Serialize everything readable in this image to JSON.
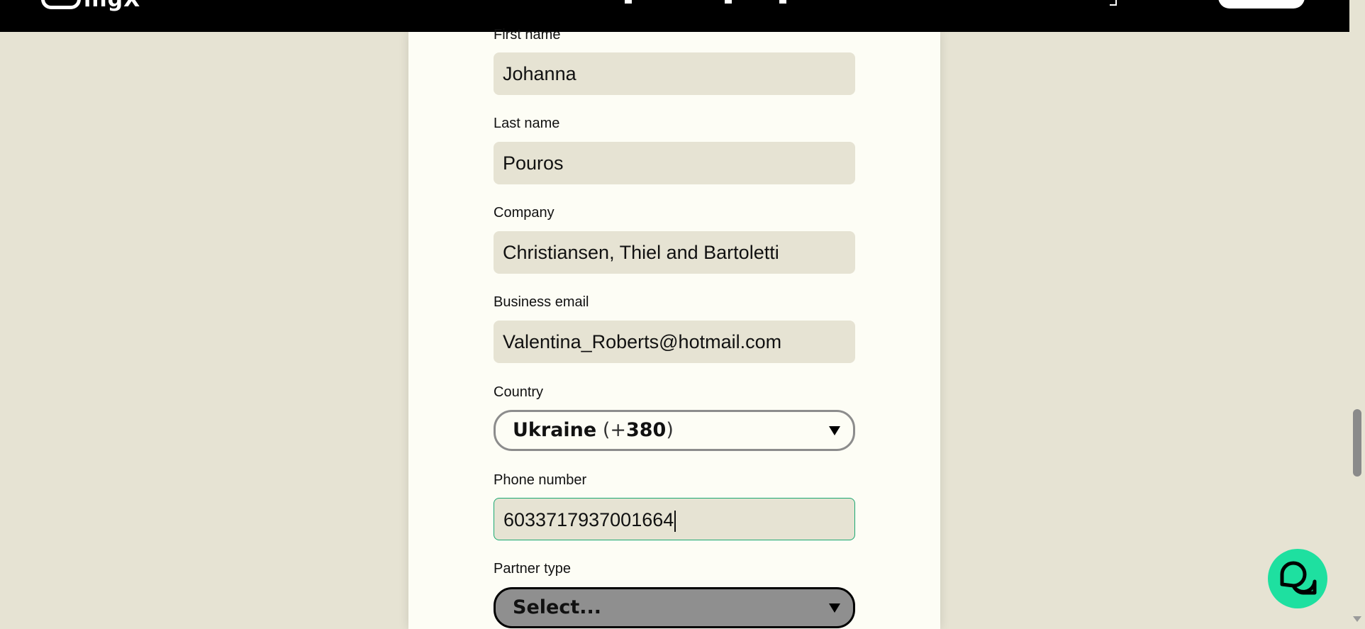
{
  "header": {
    "logo_text": "ingX"
  },
  "form": {
    "first_name": {
      "label": "First name",
      "value": "Johanna"
    },
    "last_name": {
      "label": "Last name",
      "value": "Pouros"
    },
    "company": {
      "label": "Company",
      "value": "Christiansen, Thiel and Bartoletti"
    },
    "business_email": {
      "label": "Business email",
      "value": "Valentina_Roberts@hotmail.com"
    },
    "country": {
      "label": "Country",
      "selected_name": "Ukraine",
      "code_open": "(+",
      "code_digits": "380",
      "code_close": ")"
    },
    "phone": {
      "label": "Phone number",
      "value": "6033717937001664"
    },
    "partner_type": {
      "label": "Partner type",
      "selected": "Select..."
    }
  },
  "colors": {
    "page_background": "#e6e3d3",
    "card_background": "#fdfdf5",
    "accent_green": "#1ee0a0",
    "focus_border": "#1aa871"
  },
  "icons": {
    "chat": "chat-bubbles-icon",
    "dropdown": "triangle-down-icon"
  }
}
